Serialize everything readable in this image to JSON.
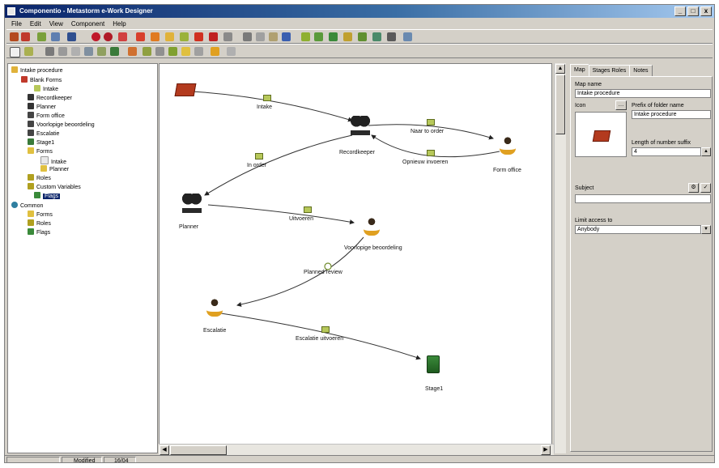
{
  "title": "Componentio - Metastorm e-Work Designer",
  "window_buttons": [
    "_",
    "□",
    "x"
  ],
  "menu": [
    "File",
    "Edit",
    "View",
    "Component",
    "Help"
  ],
  "tree": {
    "items": [
      {
        "label": "Intake procedure"
      },
      {
        "label": "Blank Forms"
      },
      {
        "label": "Intake"
      },
      {
        "label": "Recordkeeper"
      },
      {
        "label": "Planner"
      },
      {
        "label": "Form office"
      },
      {
        "label": "Voorlopige beoordeling"
      },
      {
        "label": "Escalatie"
      },
      {
        "label": "Stage1"
      },
      {
        "label": "Forms"
      },
      {
        "label": "Intake"
      },
      {
        "label": "Planner"
      },
      {
        "label": "Roles"
      },
      {
        "label": "Custom Variables"
      },
      {
        "label": "Flags"
      },
      {
        "label": "Common"
      },
      {
        "label": "Forms"
      },
      {
        "label": "Roles"
      },
      {
        "label": "Flags"
      }
    ]
  },
  "map": {
    "nodes": [
      {
        "label": "",
        "icon": "start-icon"
      },
      {
        "label": "Recordkeeper",
        "icon": "people-icon"
      },
      {
        "label": "Form office",
        "icon": "person-icon"
      },
      {
        "label": "Planner",
        "icon": "people-icon"
      },
      {
        "label": "Voorlopige beoordeling",
        "icon": "person-icon"
      },
      {
        "label": "Escalatie",
        "icon": "person-icon"
      },
      {
        "label": "Stage1",
        "icon": "stage-icon"
      }
    ],
    "edges": [
      {
        "label": "Intake"
      },
      {
        "label": "Naar to order"
      },
      {
        "label": "Opnieuw invoeren"
      },
      {
        "label": "In order"
      },
      {
        "label": "Uitvoeren"
      },
      {
        "label": "Planned review"
      },
      {
        "label": "Escalatie uitvoeren"
      }
    ]
  },
  "right_panel": {
    "tabs": [
      "Map",
      "Stages Roles",
      "Notes"
    ],
    "map_name_label": "Map name",
    "map_name_value": "Intake procedure",
    "icon_label": "Icon",
    "prefix_label": "Prefix of folder name",
    "prefix_value": "Intake procedure",
    "length_label": "Length of number suffix",
    "length_value": "4",
    "subject_label": "Subject",
    "subject_value": "",
    "limit_label": "Limit access to",
    "limit_value": "Anybody"
  },
  "status": [
    "",
    "Modified",
    "16/04"
  ]
}
